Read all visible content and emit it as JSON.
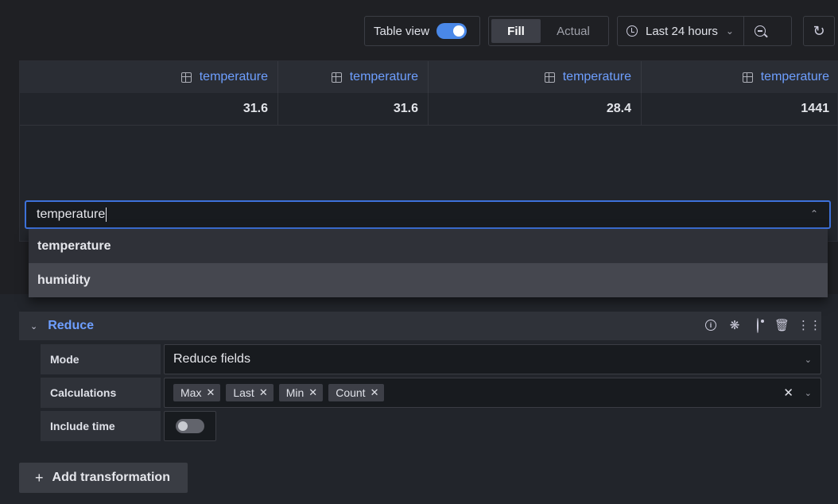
{
  "toolbar": {
    "table_view_label": "Table view",
    "table_view_on": true,
    "fill_label": "Fill",
    "actual_label": "Actual",
    "time_range": "Last 24 hours"
  },
  "table": {
    "headers": [
      "temperature",
      "temperature",
      "temperature",
      "temperature"
    ],
    "row": [
      "31.6",
      "31.6",
      "28.4",
      "1441"
    ]
  },
  "field_select": {
    "value": "temperature",
    "options": [
      "temperature",
      "humidity"
    ]
  },
  "transformation": {
    "title": "Reduce",
    "mode_label": "Mode",
    "mode_value": "Reduce fields",
    "calculations_label": "Calculations",
    "calculations": [
      "Max",
      "Last",
      "Min",
      "Count"
    ],
    "include_time_label": "Include time",
    "include_time_on": false
  },
  "add_transformation_label": "Add transformation",
  "colors": {
    "accent": "#6e9fff",
    "toggle_on": "#4a88e8",
    "focus_border": "#3d71d9",
    "background": "#1f2024"
  }
}
